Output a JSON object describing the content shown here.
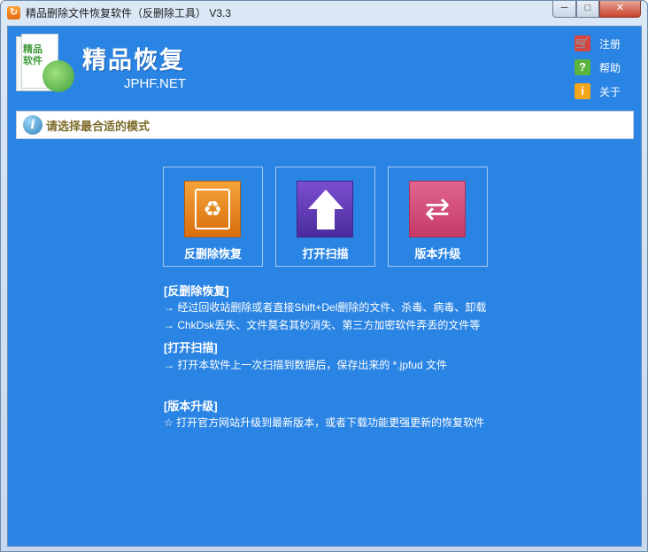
{
  "window": {
    "title": "精品删除文件恢复软件（反删除工具） V3.3",
    "app_icon": "↻",
    "minimize": "─",
    "maximize": "□",
    "close": "✕"
  },
  "brand": {
    "logo_text": "精品软件",
    "name": "精品恢复",
    "site": "JPHF.NET"
  },
  "side_links": [
    {
      "label": "注册",
      "icon": "cart-icon",
      "glyph": "🛒"
    },
    {
      "label": "帮助",
      "icon": "help-icon",
      "glyph": "?"
    },
    {
      "label": "关于",
      "icon": "info-icon",
      "glyph": "i"
    }
  ],
  "mode_bar": {
    "icon": "i",
    "label": "请选择最合适的模式"
  },
  "tiles": [
    {
      "label": "反删除恢复",
      "icon": "recycle-icon",
      "glyph": "♻"
    },
    {
      "label": "打开扫描",
      "icon": "upload-arrow-icon"
    },
    {
      "label": "版本升级",
      "icon": "refresh-icon",
      "glyph": "⇄"
    }
  ],
  "descriptions": {
    "recover_title": "[反删除恢复]",
    "recover_line1": "→ 经过回收站删除或者直接Shift+Del删除的文件、杀毒、病毒、卸载",
    "recover_line2": "→ ChkDsk丢失、文件莫名其妙消失、第三方加密软件弄丢的文件等",
    "scan_title": "[打开扫描]",
    "scan_line1": "→ 打开本软件上一次扫描到数据后，保存出来的 *.jpfud 文件",
    "upgrade_title": "[版本升级]",
    "upgrade_line1": "☆ 打开官方网站升级到最新版本，或者下载功能更强更新的恢复软件"
  },
  "colors": {
    "client_bg": "#2a84e3",
    "recover_accent": "#e88a22",
    "scan_accent": "#5a37b0",
    "upgrade_accent": "#d44d7a"
  }
}
